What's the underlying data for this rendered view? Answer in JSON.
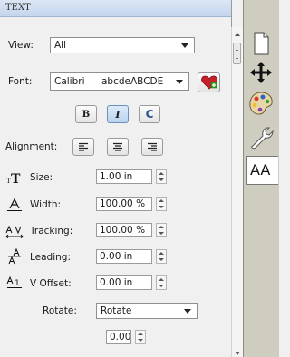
{
  "panel": {
    "title": "TEXT"
  },
  "view": {
    "label": "View:",
    "value": "All"
  },
  "font": {
    "label": "Font:",
    "name": "Calibri",
    "preview": "abcdeABCDE"
  },
  "style_buttons": {
    "bold": "B",
    "italic": "I",
    "reset": "C"
  },
  "alignment": {
    "label": "Alignment:"
  },
  "size": {
    "label": "Size:",
    "value": "1.00 in"
  },
  "width": {
    "label": "Width:",
    "value": "100.00 %"
  },
  "tracking": {
    "label": "Tracking:",
    "value": "100.00 %"
  },
  "leading": {
    "label": "Leading:",
    "value": "0.00 in"
  },
  "v_offset": {
    "label": "V Offset:",
    "value": "0.00 in"
  },
  "rotate": {
    "label": "Rotate:",
    "mode": "Rotate",
    "value": "0.00"
  },
  "dock": {
    "items": [
      "page-icon",
      "move-icon",
      "palette-icon",
      "wrench-icon",
      "text-aa-icon"
    ],
    "active_text": "AA"
  },
  "colors": {
    "header": "#c9d9ee",
    "pressed": "#c7dcf2",
    "dock": "#cfccc0"
  }
}
